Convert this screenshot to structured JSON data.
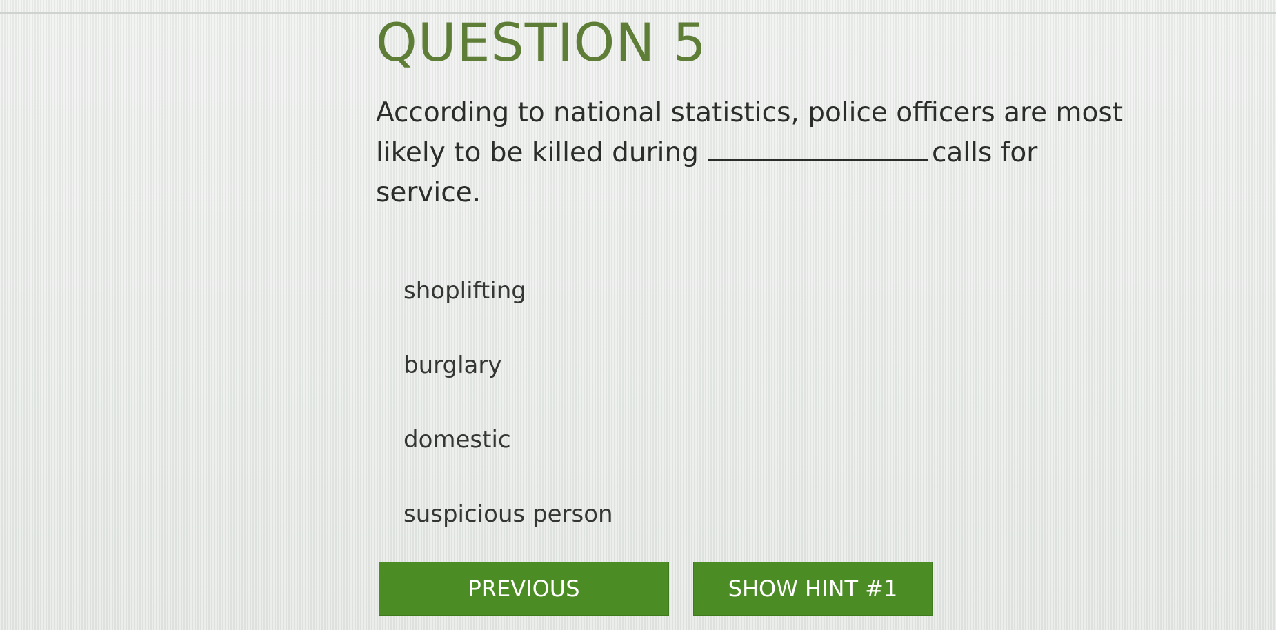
{
  "quiz": {
    "title": "QUESTION 5",
    "question_before_blank": "According to national statistics, police officers are most likely to be killed during",
    "question_after_blank": "calls for service.",
    "options": [
      {
        "label": "shoplifting"
      },
      {
        "label": "burglary"
      },
      {
        "label": "domestic"
      },
      {
        "label": "suspicious person"
      }
    ]
  },
  "buttons": {
    "previous_label": "PREVIOUS",
    "hint_label": "SHOW HINT #1"
  },
  "colors": {
    "title_green": "#5e7d36",
    "button_green": "#4c8c24",
    "background": "#eaecea"
  }
}
